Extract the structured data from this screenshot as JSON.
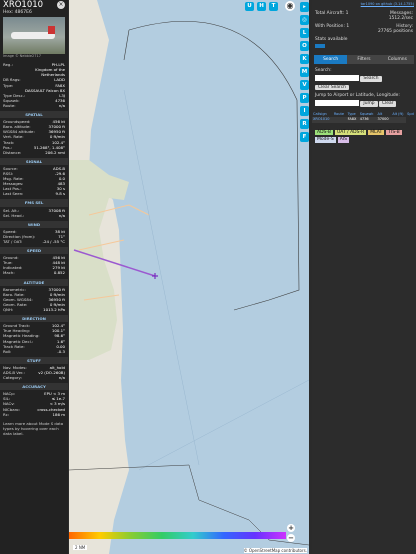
{
  "aircraft": {
    "callsign": "XRO1010",
    "hex_label": "Hex: 4867E6",
    "photo_credit": "Image © Nebbie2717",
    "reg_label": "Reg.:",
    "reg_link": "PH-LPL",
    "country": "Kingdom of the Netherlands",
    "db_flags_label": "DB flags:",
    "db_flags_link": "LADD",
    "type_label": "Type:",
    "type": "FA8X",
    "type_name": "DASSAULT Falcon 8X",
    "type_desc_label": "Type Desc.:",
    "type_desc": "L3J",
    "squawk_label": "Squawk:",
    "squawk": "4736",
    "route_label": "Route:",
    "route": "n/a"
  },
  "sections": [
    {
      "title": "SPATIAL",
      "rows": [
        [
          "Groundspeed:",
          "456 kt"
        ],
        [
          "Baro. altitude:",
          "37000 ft"
        ],
        [
          "WGS84 altitude:",
          "36950 ft"
        ],
        [
          "Vert. Rate:",
          "0 ft/min"
        ],
        [
          "Track:",
          "102.4°"
        ],
        [
          "Pos.:",
          "51.268°, 1.408°"
        ],
        [
          "Distance:",
          "206.2 nmi"
        ]
      ]
    },
    {
      "title": "SIGNAL",
      "rows": [
        [
          "Source:",
          "ADS-B"
        ],
        [
          "RSSI:",
          "-29.6"
        ],
        [
          "Msg. Rate:",
          "0.0"
        ],
        [
          "Messages:",
          "483"
        ],
        [
          "Last Pos.:",
          "30 s"
        ],
        [
          "Last Seen:",
          "9.8 s"
        ]
      ]
    },
    {
      "title": "FMS SEL",
      "rows": [
        [
          "Sel. Alt.:",
          "37008 ft"
        ],
        [
          "Sel. Head.:",
          "n/a"
        ]
      ]
    },
    {
      "title": "WIND",
      "rows": [
        [
          "Speed:",
          "38 kt"
        ],
        [
          "Direction (from):",
          "71°"
        ],
        [
          "TAT / OAT:",
          "-24 / -55 °C"
        ]
      ]
    },
    {
      "title": "SPEED",
      "rows": [
        [
          "Ground:",
          "456 kt"
        ],
        [
          "True:",
          "448 kt"
        ],
        [
          "Indicated:",
          "279 kt"
        ],
        [
          "Mach:",
          "0.852"
        ]
      ]
    },
    {
      "title": "ALTITUDE",
      "rows": [
        [
          "Barometric:",
          "37000 ft"
        ],
        [
          "Baro. Rate:",
          "0 ft/min"
        ],
        [
          "Geom. WGS84:",
          "36950 ft"
        ],
        [
          "Geom. Rate:",
          "0 ft/min"
        ],
        [
          "QNH:",
          "1013.2 hPa"
        ]
      ]
    },
    {
      "title": "DIRECTION",
      "rows": [
        [
          "Ground Track:",
          "102.4°"
        ],
        [
          "True Heading:",
          "100.1°"
        ],
        [
          "Magnetic Heading:",
          "98.6°"
        ],
        [
          "Magnetic Decl.:",
          "1.6°"
        ],
        [
          "Track Rate:",
          "0.00"
        ],
        [
          "Roll:",
          "-0.3"
        ]
      ]
    },
    {
      "title": "STUFF",
      "rows": [
        [
          "Nav. Modes:",
          "alt_hold"
        ],
        [
          "ADS-B Ver.:",
          "v2 (DO-260B)"
        ],
        [
          "Category:",
          "n/a"
        ]
      ]
    },
    {
      "title": "ACCURACY",
      "rows": [
        [
          "NACp:",
          "EPU < 3 m"
        ],
        [
          "SIL:",
          "≤ 1e-7"
        ],
        [
          "NACv:",
          "< 3 m/s"
        ],
        [
          "NICbaro:",
          "cross-checked"
        ],
        [
          "Rc:",
          "186 m"
        ]
      ]
    }
  ],
  "footer_text": "Learn more about Mode S data types by hovering over each data label.",
  "map_buttons": [
    "U",
    "H",
    "T"
  ],
  "side_buttons": [
    "L",
    "O",
    "K",
    "M",
    "V",
    "P",
    "I",
    "R",
    "F"
  ],
  "stats": {
    "total_label": "Total Aircraft:",
    "total": "1",
    "messages_label": "Messages:",
    "messages": "1512.2/sec",
    "pos_label": "With Position:",
    "pos": "1",
    "history_label": "History:",
    "history": "27765 positions",
    "stats_label": "Stats available",
    "version": "tar1090 on github (3.14.1755)"
  },
  "tabs": [
    "Search",
    "Filters",
    "Columns"
  ],
  "search": {
    "label": "Search:",
    "btn": "Search",
    "clear_btn": "Clear Search",
    "jump_label": "Jump to Airport or Latitude, Longitude:",
    "jump_btn": "Jump",
    "clear_jump_btn": "Clear"
  },
  "table": {
    "headers": [
      "Callsign",
      "Route",
      "Type",
      "Squawk",
      "Alt",
      "Alt (ft)",
      "Spd"
    ],
    "row": [
      "XRO1010",
      "",
      "FA8X",
      "4736",
      "37000",
      ""
    ]
  },
  "chips": [
    "ADS-B",
    "UAT / ADS-R",
    "MLAT",
    "TIS-B",
    "Mode-S",
    "AIS"
  ],
  "scale_label": "2 NM",
  "osm_credit": "© OpenStreetMap contributors."
}
